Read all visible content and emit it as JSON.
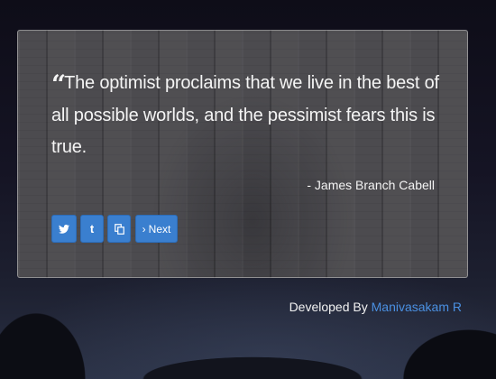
{
  "quote": {
    "mark": "“",
    "text": "The optimist proclaims that we live in the best of all possible worlds, and the pessimist fears this is true.",
    "author": "- James Branch Cabell"
  },
  "actions": {
    "twitter_icon": "twitter-icon",
    "tumblr_glyph": "t",
    "copy_icon": "copy-icon",
    "next_label": "Next",
    "next_chevron": "›"
  },
  "footer": {
    "prefix": "Developed By ",
    "author_link": "Manivasakam R"
  },
  "colors": {
    "button": "#3a7fcf",
    "link": "#4a90e2",
    "text": "#f4f4f4"
  }
}
